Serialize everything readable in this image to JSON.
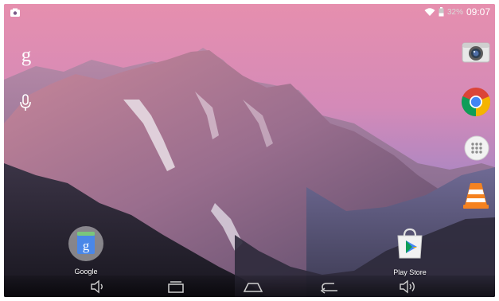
{
  "status_bar": {
    "battery_percent": "32%",
    "time": "09:07",
    "icons": [
      "notification-screenshot-icon",
      "wifi-icon",
      "battery-icon"
    ]
  },
  "search": {
    "google_glyph": "g",
    "mic_icon": "mic-icon"
  },
  "right_rail": {
    "icons": [
      "camera-icon",
      "chrome-icon",
      "app-drawer-icon",
      "vlc-icon"
    ]
  },
  "desktop": {
    "google_folder_label": "Google",
    "play_store_label": "Play Store"
  },
  "nav_bar": {
    "icons": [
      "volume-down-icon",
      "recents-icon",
      "home-icon",
      "back-icon",
      "volume-up-icon"
    ]
  },
  "colors": {
    "sky_top": "#e58fb0",
    "sky_bottom": "#6f77b8",
    "chrome_red": "#db4437",
    "chrome_green": "#0f9d58",
    "chrome_yellow": "#f4b400",
    "chrome_blue": "#4285f4",
    "vlc_orange": "#f58220"
  }
}
